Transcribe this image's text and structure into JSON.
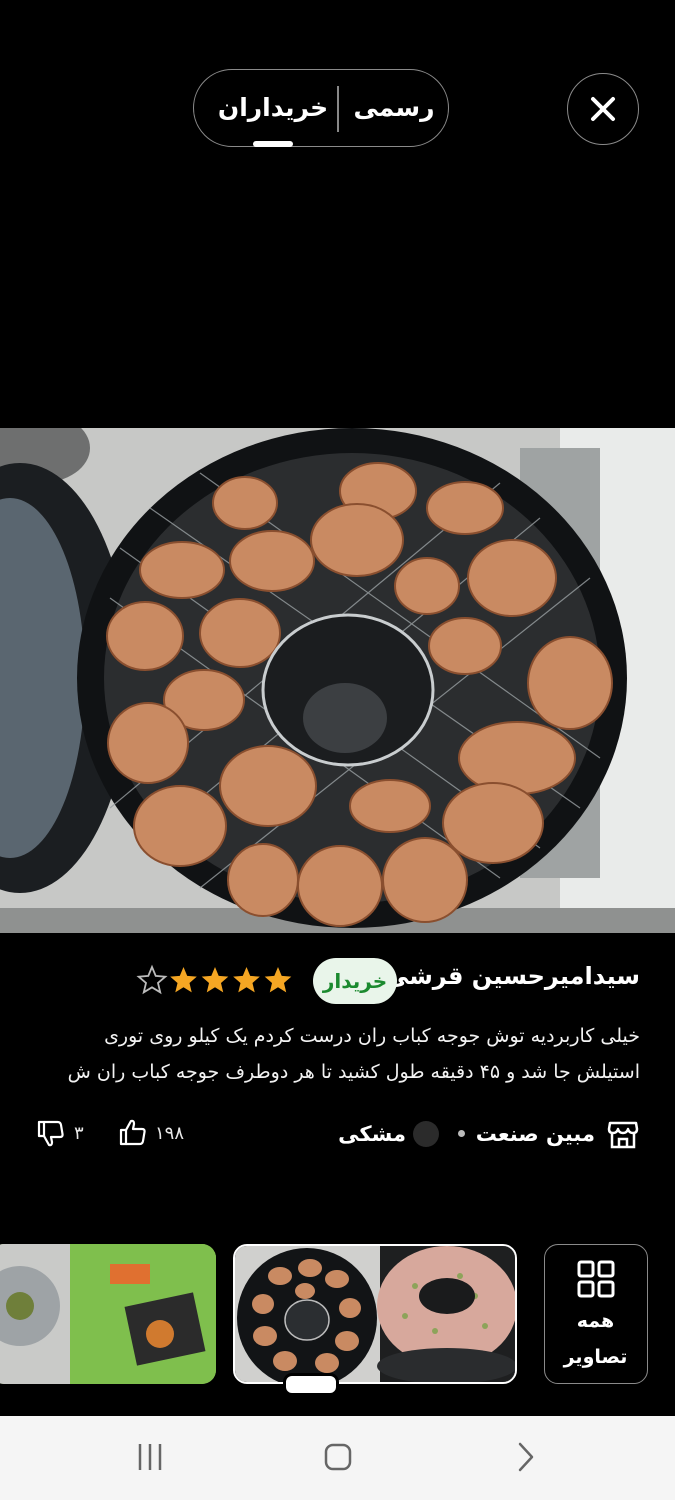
{
  "tabs": {
    "buyers_label": "خریداران",
    "official_label": "رسمی",
    "selected": "buyers"
  },
  "review": {
    "reviewer_name": "سیدامیرحسین قرشی",
    "badge": "خریدار",
    "rating": 4,
    "rating_max": 5,
    "text": "خیلی کاربردیه توش جوجه کباب ران درست کردم یک کیلو روی توری استیلش جا شد و ۴۵ دقیقه طول کشید تا هر دوطرف جوجه کباب ران ش",
    "seller": "مبین صنعت",
    "color": "مشکی",
    "likes": "۱۹۸",
    "dislikes": "۳"
  },
  "gallery": {
    "all_photos_line1": "همه",
    "all_photos_line2": "تصاویر"
  },
  "colors": {
    "background": "#000000",
    "star": "#f5a623",
    "badge_bg": "#e9f5ea",
    "badge_text": "#1b8a2f"
  },
  "icons": [
    "close-icon",
    "star-icon",
    "store-icon",
    "thumb-up-icon",
    "thumb-down-icon",
    "grid-icon",
    "recents-icon",
    "home-icon",
    "back-icon"
  ]
}
